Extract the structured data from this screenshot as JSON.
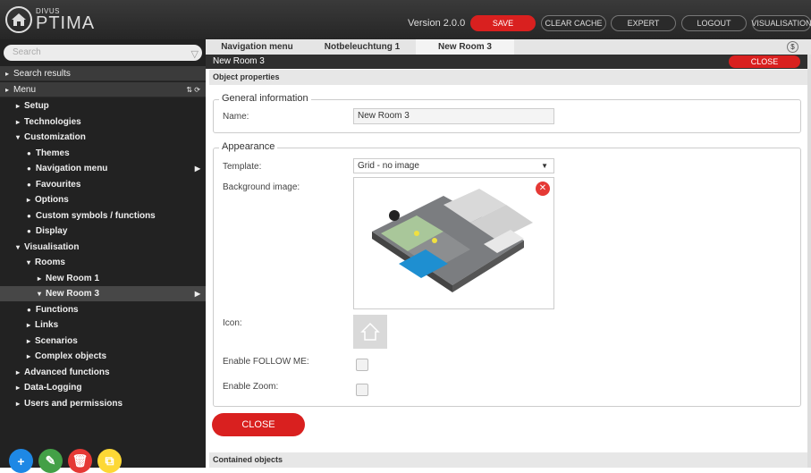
{
  "header": {
    "brand_top": "DIVUS",
    "brand_main": "PTIMA",
    "version": "Version 2.0.0",
    "buttons": {
      "save": "SAVE",
      "clear_cache": "CLEAR CACHE",
      "expert": "EXPERT",
      "logout": "LOGOUT",
      "visualisation": "VISUALISATION"
    }
  },
  "sidebar": {
    "search_placeholder": "Search",
    "items": [
      {
        "label": "Search results",
        "prefix": "▸",
        "indent": 0,
        "hdr": true
      },
      {
        "label": "Menu",
        "prefix": "▸",
        "indent": 0,
        "hdr": true
      },
      {
        "label": "Setup",
        "prefix": "▸",
        "indent": 1
      },
      {
        "label": "Technologies",
        "prefix": "▸",
        "indent": 1
      },
      {
        "label": "Customization",
        "prefix": "▾",
        "indent": 1
      },
      {
        "label": "Themes",
        "prefix": "●",
        "indent": 2
      },
      {
        "label": "Navigation menu",
        "prefix": "●",
        "indent": 2,
        "arrow": true
      },
      {
        "label": "Favourites",
        "prefix": "●",
        "indent": 2
      },
      {
        "label": "Options",
        "prefix": "▸",
        "indent": 2
      },
      {
        "label": "Custom symbols / functions",
        "prefix": "●",
        "indent": 2
      },
      {
        "label": "Display",
        "prefix": "●",
        "indent": 2
      },
      {
        "label": "Visualisation",
        "prefix": "▾",
        "indent": 1
      },
      {
        "label": "Rooms",
        "prefix": "▾",
        "indent": 2
      },
      {
        "label": "New Room 1",
        "prefix": "▸",
        "indent": 3
      },
      {
        "label": "New Room 3",
        "prefix": "▾",
        "indent": 3,
        "arrow": true,
        "selected": true
      },
      {
        "label": "Functions",
        "prefix": "●",
        "indent": 2
      },
      {
        "label": "Links",
        "prefix": "▸",
        "indent": 2
      },
      {
        "label": "Scenarios",
        "prefix": "▸",
        "indent": 2
      },
      {
        "label": "Complex objects",
        "prefix": "▸",
        "indent": 2
      },
      {
        "label": "Advanced functions",
        "prefix": "▸",
        "indent": 1
      },
      {
        "label": "Data-Logging",
        "prefix": "▸",
        "indent": 1
      },
      {
        "label": "Users and permissions",
        "prefix": "▸",
        "indent": 1
      }
    ],
    "fab": [
      {
        "name": "add",
        "icon": "+",
        "color": "#1e88e5"
      },
      {
        "name": "edit",
        "icon": "✎",
        "color": "#43a047"
      },
      {
        "name": "delete",
        "icon": "🗑",
        "color": "#e53935"
      },
      {
        "name": "copy",
        "icon": "⧉",
        "color": "#fdd835"
      }
    ]
  },
  "tabs": [
    "Navigation menu",
    "Notbeleuchtung 1",
    "New Room 3"
  ],
  "breadcrumb": "New Room 3",
  "close_label": "CLOSE",
  "sections": {
    "object_properties": "Object properties",
    "general_information": "General information",
    "appearance": "Appearance",
    "contained_objects": "Contained objects"
  },
  "form": {
    "name_label": "Name:",
    "name_value": "New Room 3",
    "template_label": "Template:",
    "template_value": "Grid - no image",
    "background_label": "Background image:",
    "icon_label": "Icon:",
    "follow_me_label": "Enable FOLLOW ME:",
    "zoom_label": "Enable Zoom:"
  },
  "colors": {
    "accent": "#d9201f",
    "dark": "#222222"
  }
}
